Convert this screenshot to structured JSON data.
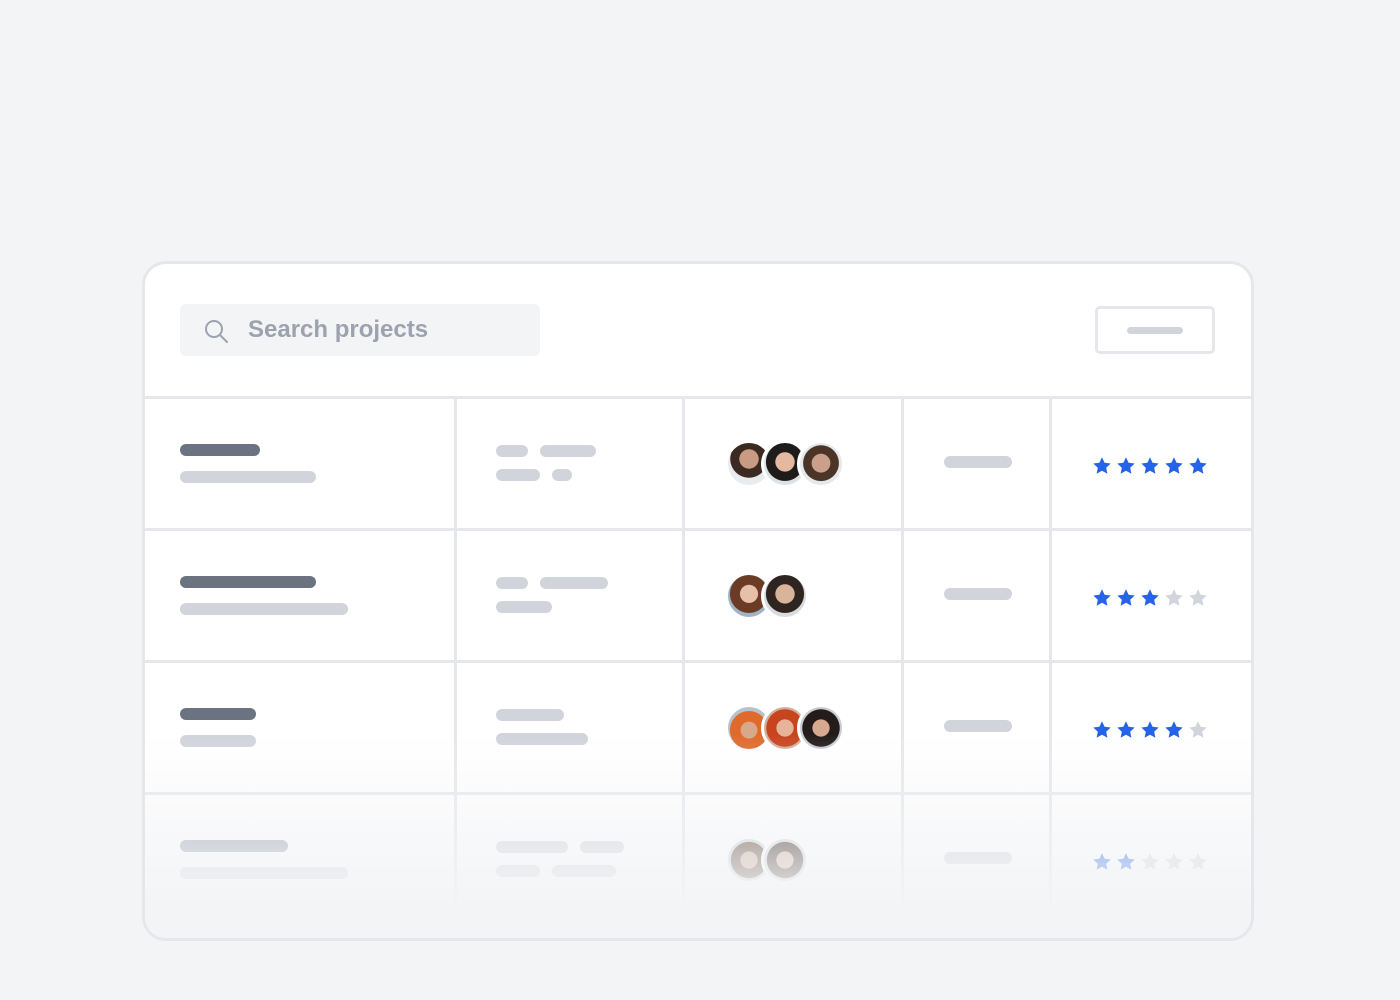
{
  "search": {
    "placeholder": "Search projects",
    "icon": "search-icon"
  },
  "colors": {
    "accent": "#2563eb",
    "star_off": "#d1d5db",
    "text_dark": "#6b7280",
    "text_light": "#d1d5db"
  },
  "rows": [
    {
      "rating": 5,
      "max_rating": 5,
      "members": [
        "avatar-curly-hair",
        "avatar-smiling-woman",
        "avatar-young-man"
      ]
    },
    {
      "rating": 3,
      "max_rating": 5,
      "members": [
        "avatar-woman-long-hair",
        "avatar-woman-dark-hair"
      ]
    },
    {
      "rating": 4,
      "max_rating": 5,
      "members": [
        "avatar-orange-beanie",
        "avatar-red-hair",
        "avatar-laughing-woman"
      ]
    },
    {
      "rating": 2,
      "max_rating": 5,
      "members": [
        "avatar-bearded-man",
        "avatar-man-glasses"
      ]
    }
  ]
}
